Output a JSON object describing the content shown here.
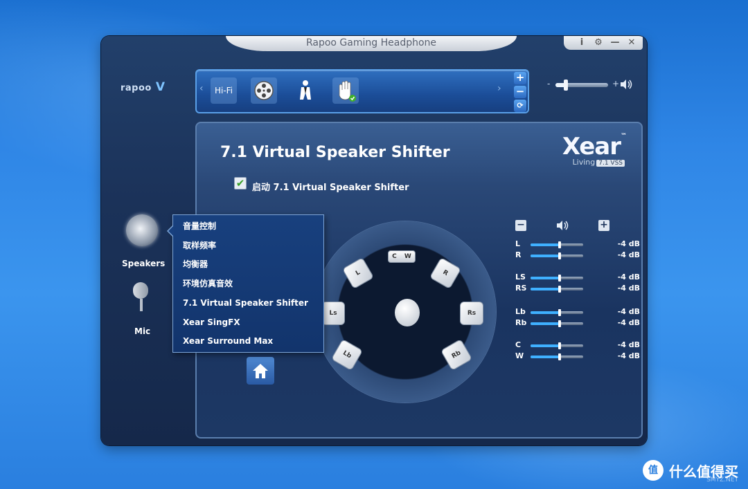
{
  "window": {
    "title": "Rapoo Gaming Headphone",
    "buttons": [
      "i",
      "⚙",
      "—",
      "✕"
    ]
  },
  "logo": {
    "brand": "rapoo",
    "mark": "V"
  },
  "toolbar": {
    "left_arrow": "‹",
    "right_arrow": "›",
    "items": [
      {
        "label": "Hi-Fi",
        "icon": "hifi-icon"
      },
      {
        "label": "",
        "icon": "film-reel-icon"
      },
      {
        "label": "",
        "icon": "person-icon"
      },
      {
        "label": "",
        "icon": "hand-icon"
      }
    ],
    "plus": "+",
    "minus": "−",
    "refresh": "⟳"
  },
  "volume": {
    "minus": "-",
    "plus": "+",
    "level": 0.2
  },
  "panel": {
    "title": "7.1 Virtual Speaker Shifter",
    "enable_label": "启动 7.1 Virtual Speaker Shifter",
    "enable_checked": true,
    "xear_logo": "Xear",
    "xear_tm": "™",
    "xear_sub": "Living",
    "xear_badge": "7.1 VSS"
  },
  "speakers": {
    "C": "C",
    "W": "W",
    "L": "L",
    "R": "R",
    "Ls": "Ls",
    "Rs": "Rs",
    "Lb": "Lb",
    "Rb": "Rb"
  },
  "levels": {
    "minus": "−",
    "plus": "+",
    "rows": [
      {
        "label": "L",
        "value": "-4 dB",
        "level": 0.55
      },
      {
        "label": "R",
        "value": "-4 dB",
        "level": 0.55
      },
      {
        "label": "LS",
        "value": "-4 dB",
        "level": 0.55
      },
      {
        "label": "RS",
        "value": "-4 dB",
        "level": 0.55
      },
      {
        "label": "Lb",
        "value": "-4 dB",
        "level": 0.55
      },
      {
        "label": "Rb",
        "value": "-4 dB",
        "level": 0.55
      },
      {
        "label": "C",
        "value": "-4 dB",
        "level": 0.55
      },
      {
        "label": "W",
        "value": "-4 dB",
        "level": 0.55
      }
    ]
  },
  "sidebar": {
    "speakers_label": "Speakers",
    "mic_label": "Mic"
  },
  "menu": {
    "items": [
      "音量控制",
      "取样频率",
      "均衡器",
      "环境仿真音效",
      "7.1 Virtual Speaker Shifter",
      "Xear SingFX",
      "Xear Surround Max"
    ]
  },
  "watermark": {
    "badge": "值",
    "text": "什么值得买",
    "small": "SMYZ.NET"
  }
}
